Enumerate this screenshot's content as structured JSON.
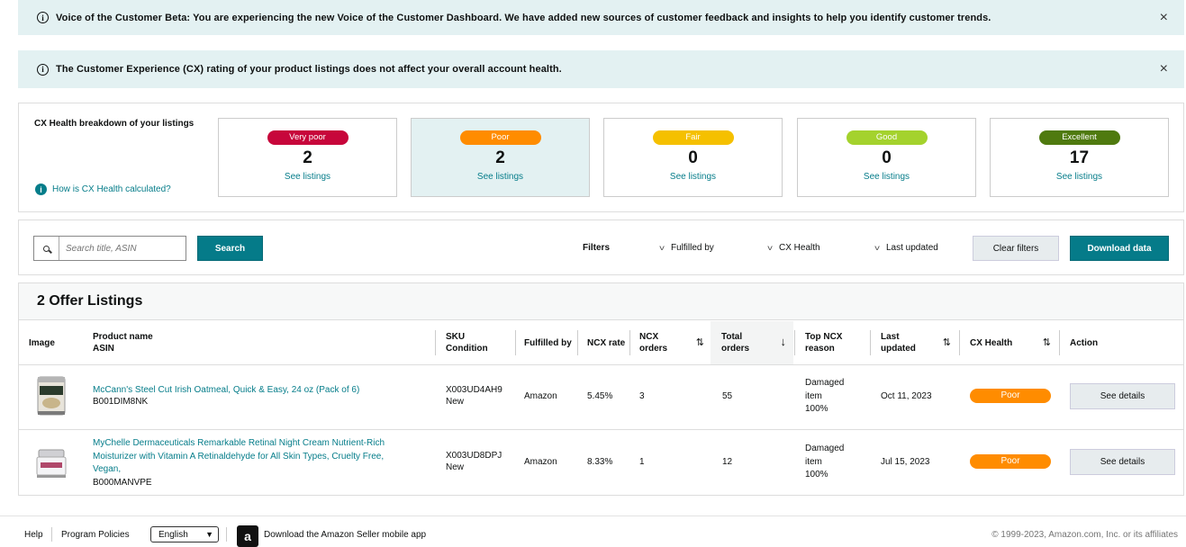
{
  "banners": [
    {
      "text": "Voice of the Customer Beta: You are experiencing the new Voice of the Customer Dashboard. We have added new sources of customer feedback and insights to help you identify customer trends.",
      "icon": "info-icon",
      "close": "×"
    },
    {
      "text": "The Customer Experience (CX) rating of your product listings does not affect your overall account health.",
      "icon": "info-icon",
      "close": "×"
    }
  ],
  "health": {
    "title": "CX Health breakdown of your listings",
    "help_link": "How is CX Health calculated?",
    "cards": [
      {
        "label": "Very poor",
        "count": "2",
        "link": "See listings",
        "color": "#c7063b"
      },
      {
        "label": "Poor",
        "count": "2",
        "link": "See listings",
        "color": "#ff8c00"
      },
      {
        "label": "Fair",
        "count": "0",
        "link": "See listings",
        "color": "#f5c000"
      },
      {
        "label": "Good",
        "count": "0",
        "link": "See listings",
        "color": "#a4d22d"
      },
      {
        "label": "Excellent",
        "count": "17",
        "link": "See listings",
        "color": "#4f7a0f"
      }
    ]
  },
  "filters": {
    "search_placeholder": "Search title, ASIN",
    "search_button": "Search",
    "label": "Filters",
    "dropdowns": [
      "Fulfilled by",
      "CX Health",
      "Last updated"
    ],
    "clear_button": "Clear filters",
    "download_button": "Download data"
  },
  "listings": {
    "title": "2 Offer Listings",
    "columns": {
      "image": "Image",
      "product": [
        "Product name",
        "ASIN"
      ],
      "sku": [
        "SKU",
        "Condition"
      ],
      "fulfilled": "Fulfilled by",
      "ncx_rate": "NCX rate",
      "ncx_orders": [
        "NCX",
        "orders"
      ],
      "total_orders": [
        "Total",
        "orders"
      ],
      "top_reason": [
        "Top NCX",
        "reason"
      ],
      "last_updated": [
        "Last",
        "updated"
      ],
      "cx_health": "CX Health",
      "action": "Action"
    },
    "rows": [
      {
        "product": "McCann's Steel Cut Irish Oatmeal, Quick & Easy, 24 oz (Pack of 6)",
        "asin": "B001DIM8NK",
        "sku": "X003UD4AH9",
        "condition": "New",
        "fulfilled": "Amazon",
        "ncx_rate": "5.45%",
        "ncx_orders": "3",
        "total_orders": "55",
        "reason": [
          "Damaged",
          "item",
          "100%"
        ],
        "updated": "Oct 11, 2023",
        "health": "Poor",
        "action": "See details"
      },
      {
        "product_lines": [
          "MyChelle Dermaceuticals Remarkable Retinal Night Cream Nutrient-Rich",
          "Moisturizer with Vitamin A Retinaldehyde for All Skin Types, Cruelty Free,",
          "Vegan,"
        ],
        "asin": "B000MANVPE",
        "sku": "X003UD8DPJ",
        "condition": "New",
        "fulfilled": "Amazon",
        "ncx_rate": "8.33%",
        "ncx_orders": "1",
        "total_orders": "12",
        "reason": [
          "Damaged",
          "item",
          "100%"
        ],
        "updated": "Jul 15, 2023",
        "health": "Poor",
        "action": "See details"
      }
    ]
  },
  "footer": {
    "help": "Help",
    "policies": "Program Policies",
    "language": "English",
    "app_link": "Download the Amazon Seller mobile app",
    "copyright": "© 1999-2023, Amazon.com, Inc. or its affiliates"
  }
}
